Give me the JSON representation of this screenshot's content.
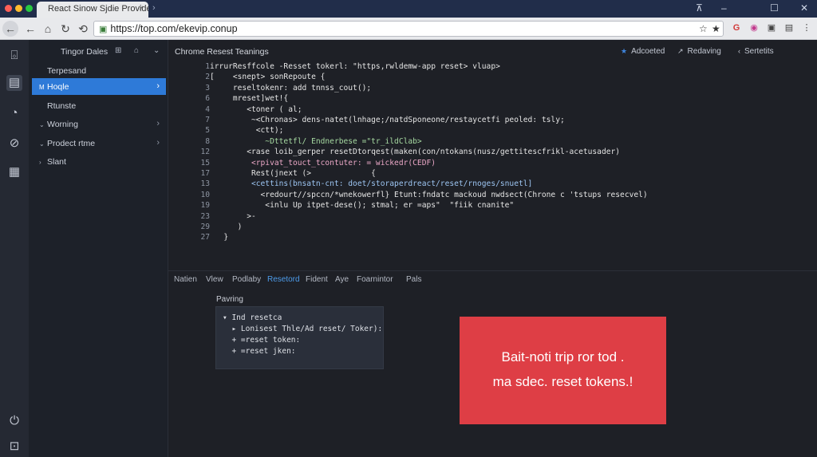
{
  "browser": {
    "tab_title": "React Sinow Sjdie Provide",
    "tab_close": "×",
    "new_tab": "›",
    "address": "https://top.com/ekevip.conup",
    "window_controls": [
      "⊼",
      "–",
      "☐",
      "✕"
    ],
    "extensions": [
      "☆",
      "★",
      "G",
      "◉",
      "▣",
      "▤"
    ]
  },
  "rail": {
    "icons": [
      "suitcase-icon",
      "lock-icon",
      "pie-icon",
      "compass-icon",
      "grid-icon",
      "power-icon",
      "bell-icon"
    ]
  },
  "sidebar": {
    "header": "Tingor Dales",
    "header_icons": [
      "⊞",
      "⌂",
      "⌄"
    ],
    "items": [
      {
        "caret": "",
        "label": "Terpesand",
        "chevron": ""
      },
      {
        "caret": "M",
        "label": "Hoqle",
        "chevron": "›"
      },
      {
        "caret": "",
        "label": "Rtunste",
        "chevron": ""
      },
      {
        "caret": "⌄",
        "label": "Worning",
        "chevron": "›"
      },
      {
        "caret": "⌄",
        "label": "Prodect rtme",
        "chevron": "›"
      },
      {
        "caret": "›",
        "label": "Slant",
        "chevron": ""
      }
    ]
  },
  "main": {
    "title": "Chrome Resest Teanings",
    "header_buttons": [
      {
        "icon": "★",
        "label": "Adcoeted"
      },
      {
        "icon": "↗",
        "label": "Redaving"
      },
      {
        "icon": "‹",
        "label": "Sertetits"
      }
    ]
  },
  "code_lines": [
    {
      "n": "1",
      "text": "irrurResffcole -Resset tokerl: \"https,rwldemw-app reset> vluap>",
      "cls": ""
    },
    {
      "n": "2",
      "text": "[    <snept> sonRepoute {",
      "cls": ""
    },
    {
      "n": "3",
      "text": "     reseltokenr: add tnnss_cout();",
      "cls": ""
    },
    {
      "n": "6",
      "text": "     mreset]wet!{",
      "cls": ""
    },
    {
      "n": "4",
      "text": "        <toner ( al;",
      "cls": ""
    },
    {
      "n": "7",
      "text": "         ~<Chronas> dens-natet(lnhage;/natdSponeone/restaycetfi peoled: tsly;",
      "cls": ""
    },
    {
      "n": "5",
      "text": "          <ctt);",
      "cls": ""
    },
    {
      "n": "8",
      "text": "            ~Dttetfl/ Endnerbese =\"tr_ildClab>",
      "cls": "c-grn"
    },
    {
      "n": "12",
      "text": "        <rase loib_gerper resetDtorqest(maken(con/ntokans(nusz/gettitescfrikl-acetusader)",
      "cls": ""
    },
    {
      "n": "15",
      "text": "         <rpivat_touct_tcontuter: = wickedr(CEDF)",
      "cls": "c-pnk"
    },
    {
      "n": "17",
      "text": "         Rest(jnext (>             {",
      "cls": ""
    },
    {
      "n": "13",
      "text": "         <cettins(bnsatn-cnt: doet/storaperdreact/reset/rnoges/snuetl]",
      "cls": "c-blu"
    },
    {
      "n": "10",
      "text": "           <redourt//spccn/*wnekowerfl} Etunt:fndatc mackoud nwdsect(Chrone c 'tstups resecvel)",
      "cls": ""
    },
    {
      "n": "19",
      "text": "            <inlu Up itpet-dese(); stmal; er =aps\"  \"fiik cnanite\"",
      "cls": ""
    },
    {
      "n": "23",
      "text": "        >-",
      "cls": ""
    },
    {
      "n": "29",
      "text": "      )",
      "cls": ""
    },
    {
      "n": "27",
      "text": "   }",
      "cls": ""
    }
  ],
  "bottom_tabs": [
    {
      "label": "Natien",
      "active": false
    },
    {
      "label": "Vlew",
      "active": false
    },
    {
      "label": "Podlaby",
      "active": false
    },
    {
      "label": "Resetord",
      "active": true
    },
    {
      "label": "Fident",
      "active": false
    },
    {
      "label": "Aye",
      "active": false
    },
    {
      "label": "Foarnintor",
      "active": false
    },
    {
      "label": "Pals",
      "active": false
    }
  ],
  "panel": {
    "label": "Pavring",
    "lines": [
      "▾ Ind resetca",
      "  ▸ Lonisest Thle/Ad reset/ Toker):",
      "  + =reset token:",
      "  + =reset jken:"
    ]
  },
  "alert": {
    "line1": "Bait-noti trip ror tod .",
    "line2": "ma sdec. reset tokens.!",
    "color": "#de3e45"
  }
}
